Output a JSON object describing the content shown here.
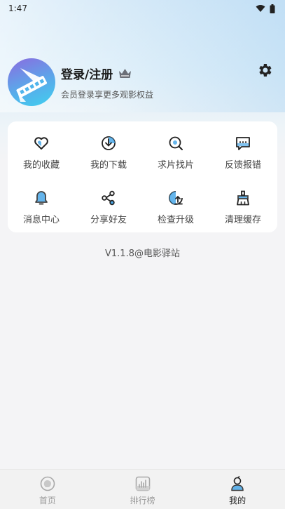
{
  "status_bar": {
    "time": "1:47"
  },
  "profile": {
    "login_label": "登录/注册",
    "subtitle": "会员登录享更多观影权益"
  },
  "menu": [
    {
      "label": "我的收藏",
      "icon": "heart-icon"
    },
    {
      "label": "我的下载",
      "icon": "download-icon"
    },
    {
      "label": "求片找片",
      "icon": "search-film-icon"
    },
    {
      "label": "反馈报错",
      "icon": "feedback-icon"
    },
    {
      "label": "消息中心",
      "icon": "bell-icon"
    },
    {
      "label": "分享好友",
      "icon": "share-icon"
    },
    {
      "label": "检查升级",
      "icon": "upgrade-icon"
    },
    {
      "label": "清理缓存",
      "icon": "broom-icon"
    }
  ],
  "version": "V1.1.8@电影驿站",
  "tabbar": {
    "tabs": [
      {
        "label": "首页",
        "icon": "home-icon"
      },
      {
        "label": "排行榜",
        "icon": "ranking-icon"
      },
      {
        "label": "我的",
        "icon": "profile-icon"
      }
    ],
    "active_index": 2
  },
  "colors": {
    "accent": "#4aa8e8",
    "icon_stroke": "#222222"
  }
}
